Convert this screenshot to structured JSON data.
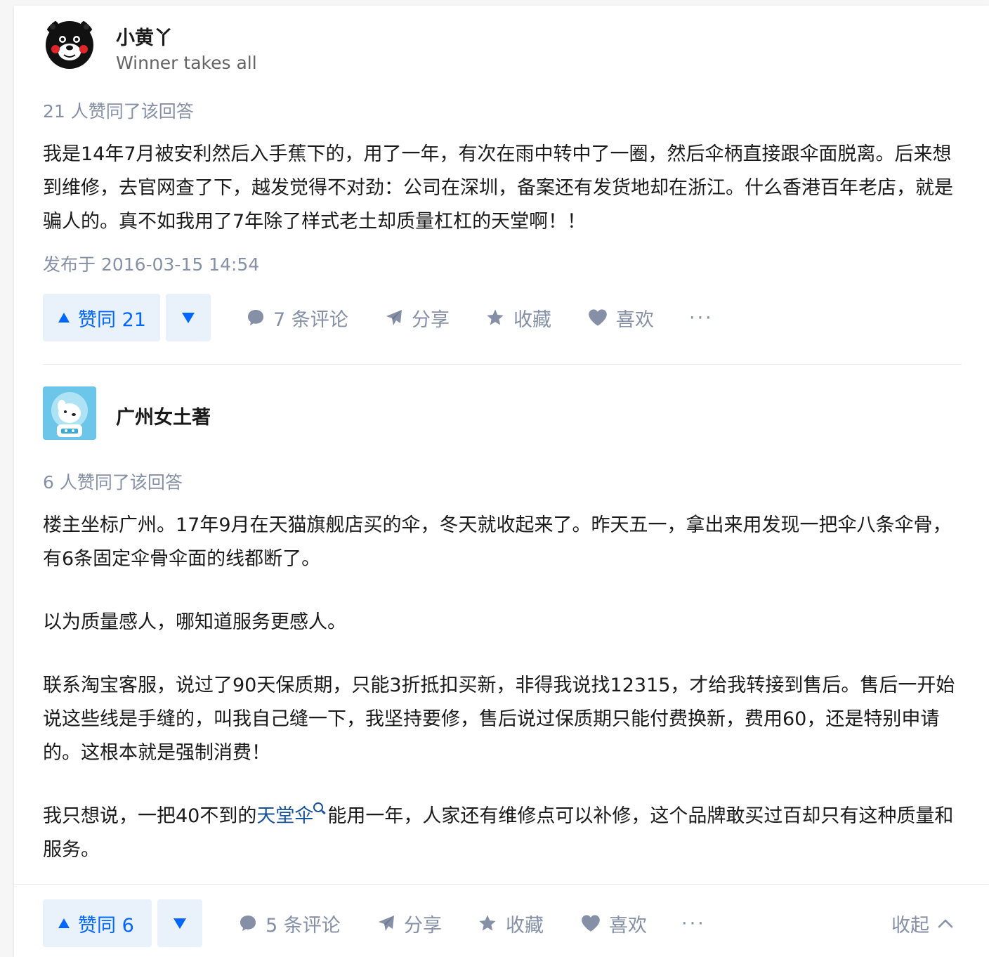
{
  "answers": [
    {
      "author_name": "小黄丫",
      "author_headline": "Winner takes all",
      "votes_info": "21 人赞同了该回答",
      "paragraphs": [
        "我是14年7月被安利然后入手蕉下的，用了一年，有次在雨中转中了一圈，然后伞柄直接跟伞面脱离。后来想到维修，去官网查了下，越发觉得不对劲：公司在深圳，备案还有发货地却在浙江。什么香港百年老店，就是骗人的。真不如我用了7年除了样式老土却质量杠杠的天堂啊！！"
      ],
      "publish_time": "发布于 2016-03-15 14:54",
      "actions": {
        "vote_up": "赞同 21",
        "comments": "7 条评论",
        "share": "分享",
        "collect": "收藏",
        "like": "喜欢",
        "more": "···"
      }
    },
    {
      "author_name": "广州女土著",
      "votes_info": "6 人赞同了该回答",
      "paragraph_1": "楼主坐标广州。17年9月在天猫旗舰店买的伞，冬天就收起来了。昨天五一，拿出来用发现一把伞八条伞骨，有6条固定伞骨伞面的线都断了。",
      "paragraph_2": "以为质量感人，哪知道服务更感人。",
      "paragraph_3": "联系淘宝客服，说过了90天保质期，只能3折抵扣买新，非得我说找12315，才给我转接到售后。售后一开始说这些线是手缝的，叫我自己缝一下，我坚持要修，售后说过保质期只能付费换新，费用60，还是特别申请的。这根本就是强制消费！",
      "paragraph_4_before": "我只想说，一把40不到的",
      "paragraph_4_link": "天堂伞",
      "paragraph_4_after": "能用一年，人家还有维修点可以补修，这个品牌敢买过百却只有这种质量和服务。",
      "actions": {
        "vote_up": "赞同 6",
        "comments": "5 条评论",
        "share": "分享",
        "collect": "收藏",
        "like": "喜欢",
        "more": "···",
        "collapse": "收起"
      }
    }
  ],
  "icons": {
    "comment": "comment-bubble-icon",
    "share": "paper-plane-icon",
    "collect": "star-icon",
    "like": "heart-icon",
    "collapse": "chevron-up-icon",
    "search": "search-icon"
  },
  "colors": {
    "accent": "#0066ff",
    "link": "#175199",
    "muted": "#8590a6",
    "vote_bg": "#e9f1fb"
  }
}
